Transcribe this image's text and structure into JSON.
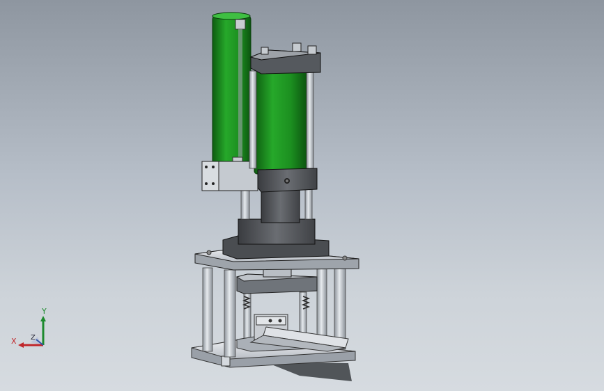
{
  "viewport": {
    "background_top": "#8e96a0",
    "background_bottom": "#d6dbe0"
  },
  "model": {
    "colors": {
      "cylinder_green": "#1f9a22",
      "cylinder_green_dark": "#0f6a12",
      "block_gray": "#5a5d61",
      "block_gray_dark": "#3c3e41",
      "plate_light": "#d8dce2",
      "rod_light": "#c7cdd4"
    },
    "icons": [
      "green-cylinder-left",
      "green-cylinder-right",
      "cylinder-mount-block",
      "base-plate",
      "guide-rod",
      "chute-tray"
    ]
  },
  "triad": {
    "x_label": "X",
    "y_label": "Y",
    "z_label": "Z",
    "x_color": "#c0262a",
    "y_color": "#1d8a2e",
    "z_color": "#3355aa"
  }
}
